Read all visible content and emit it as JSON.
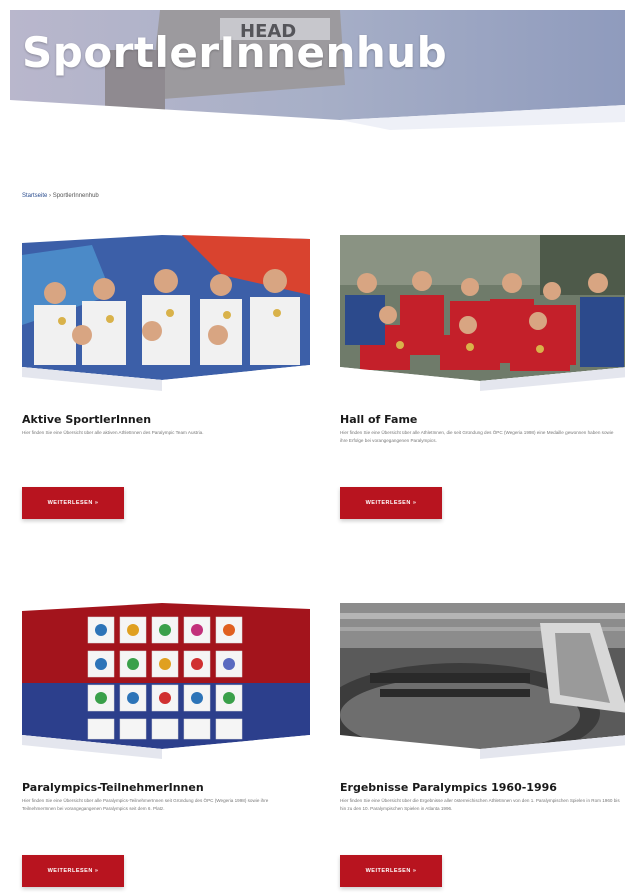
{
  "hero": {
    "title": "SportlerInnenhub"
  },
  "breadcrumb": {
    "home": "Startseite",
    "separator": " › ",
    "current": "SportlerInnenhub"
  },
  "cards": [
    {
      "title": "Aktive SportlerInnen",
      "text": "Hier finden Sie eine Übersicht über alle aktiven AthletInnen des Paralympic Team Austria.",
      "button": "WEITERLESEN »"
    },
    {
      "title": "Hall of Fame",
      "text": "Hier finden Sie eine Übersicht über alle AthletInnen, die seit Gründung des ÖPC (Wegeria 1998) eine Medaille gewonnen haben sowie ihre Erfolge bei vorangegangenen Paralympics.",
      "button": "WEITERLESEN »"
    },
    {
      "title": "Paralympics-TeilnehmerInnen",
      "text": "Hier finden Sie eine Übersicht über alle Paralympics-TeilnehmerInnen seit Gründung des ÖPC (Wegeria 1998) sowie ihre TeilnehmerInnen bei vorangegangenen Paralympics seit dem 6. Platz.",
      "button": "WEITERLESEN »"
    },
    {
      "title": "Ergebnisse Paralympics 1960-1996",
      "text": "Hier finden Sie eine Übersicht über die Ergebnisse aller österreichischen AthletInnen von den 1. Paralympischen Spielen in Rom 1960 bis hin zu den 10. Paralympischen Spielen in Atlanta 1996.",
      "button": "WEITERLESEN »"
    }
  ],
  "colors": {
    "accent": "#b8141f",
    "link": "#2a4d8f"
  },
  "icons": [
    "paralympics-emblem-icon"
  ]
}
